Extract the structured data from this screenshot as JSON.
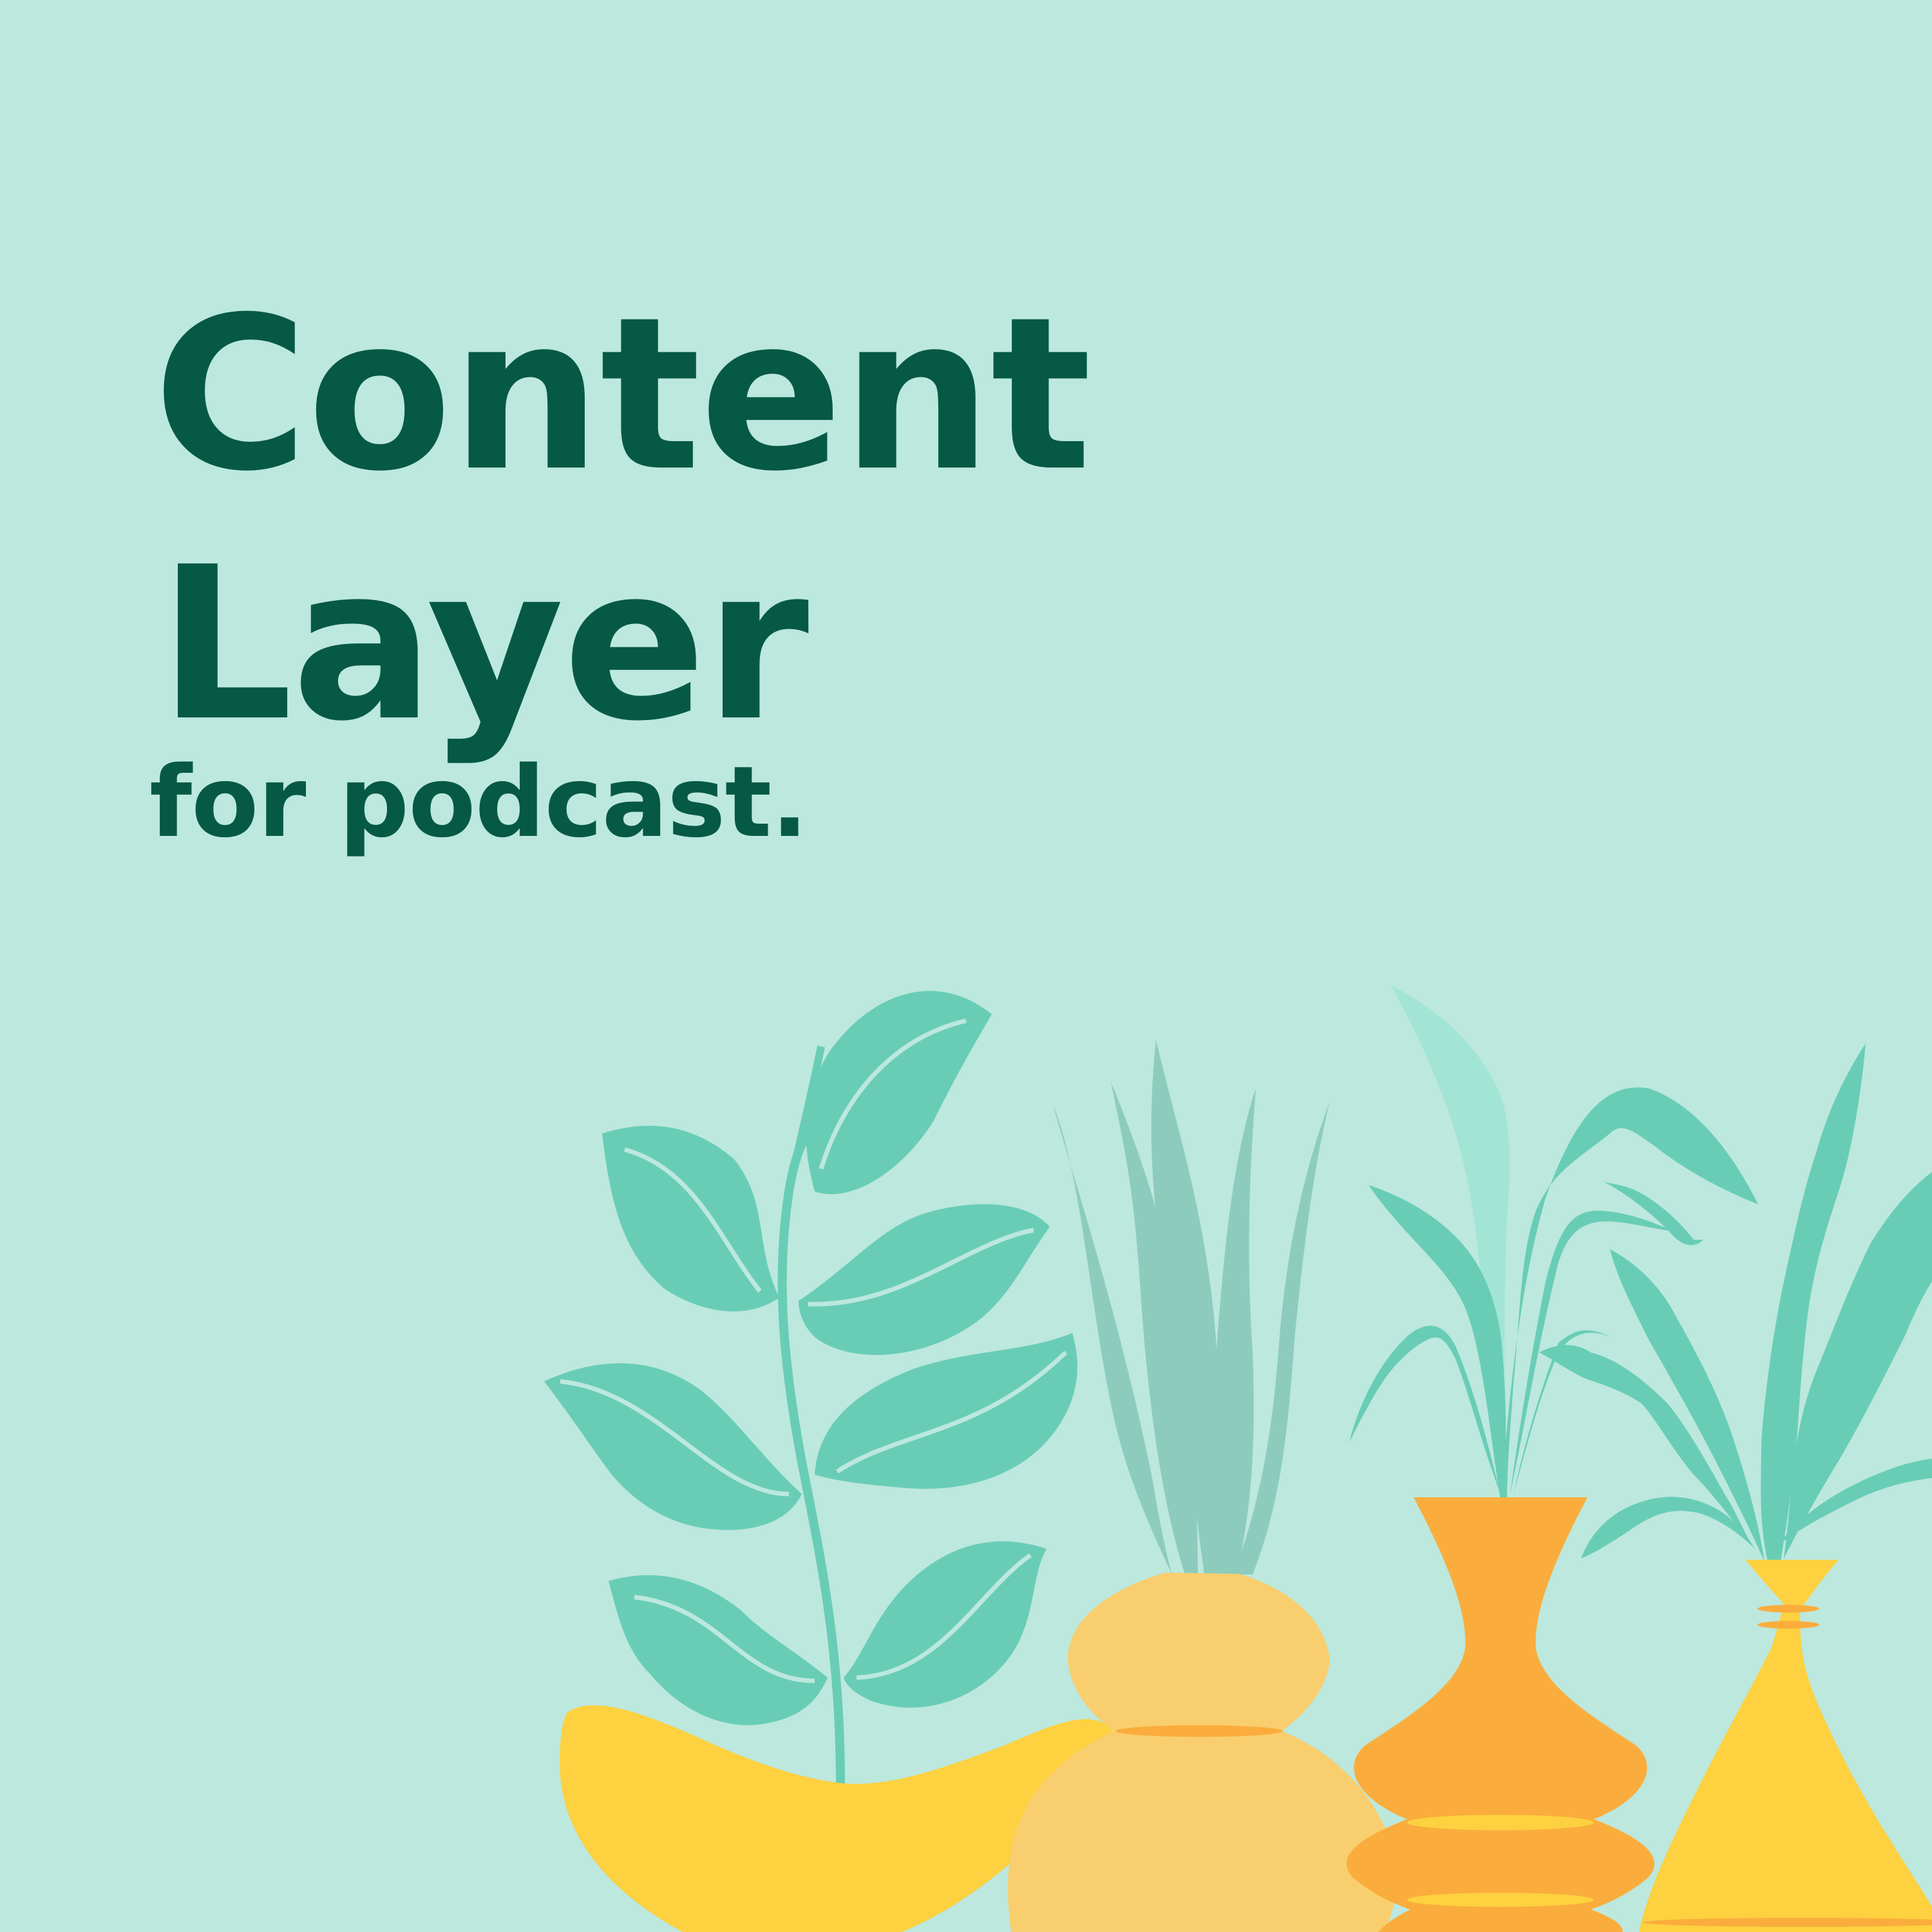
{
  "cover": {
    "title_line_1": "Content",
    "title_line_2": "Layer",
    "subtitle": "for podcast."
  },
  "colors": {
    "background": "#bce8de",
    "text": "#065945",
    "leaf": "#69cdb5",
    "leaf_pale": "#8dccbc",
    "leaf_light": "#a3e5d5",
    "vase_yellow": "#fdd13f",
    "vase_peach": "#f9ce6e",
    "vase_orange": "#faad3c"
  },
  "illustration": {
    "icon": "potted-plants-illustration"
  }
}
